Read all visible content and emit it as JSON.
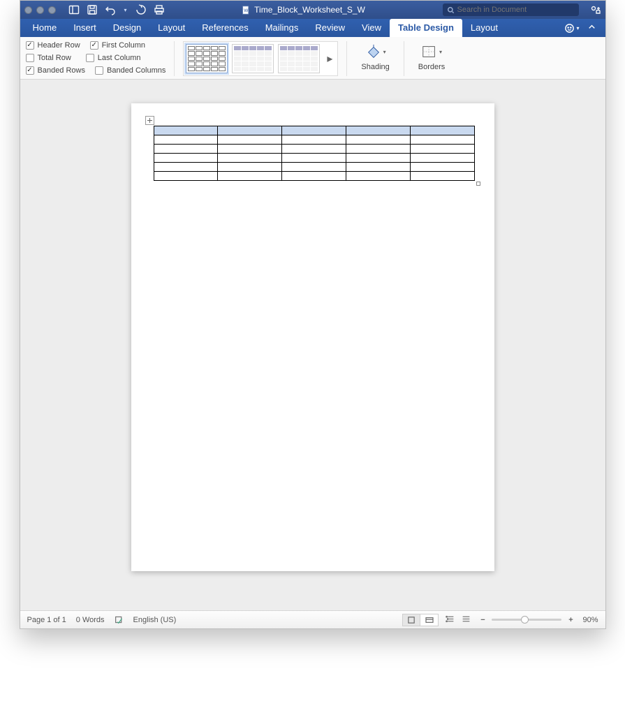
{
  "titlebar": {
    "document_name": "Time_Block_Worksheet_S_W"
  },
  "search": {
    "placeholder": "Search in Document"
  },
  "tabs": {
    "items": [
      "Home",
      "Insert",
      "Design",
      "Layout",
      "References",
      "Mailings",
      "Review",
      "View",
      "Table Design",
      "Layout"
    ],
    "active_index": 8
  },
  "ribbon": {
    "options": {
      "header_row": {
        "label": "Header Row",
        "checked": true
      },
      "first_column": {
        "label": "First Column",
        "checked": true
      },
      "total_row": {
        "label": "Total Row",
        "checked": false
      },
      "last_column": {
        "label": "Last Column",
        "checked": false
      },
      "banded_rows": {
        "label": "Banded Rows",
        "checked": true
      },
      "banded_columns": {
        "label": "Banded Columns",
        "checked": false
      }
    },
    "shading_label": "Shading",
    "borders_label": "Borders"
  },
  "document_table": {
    "rows": 6,
    "cols": 5
  },
  "status": {
    "page": "Page 1 of 1",
    "words": "0 Words",
    "language": "English (US)",
    "zoom": "90%"
  }
}
